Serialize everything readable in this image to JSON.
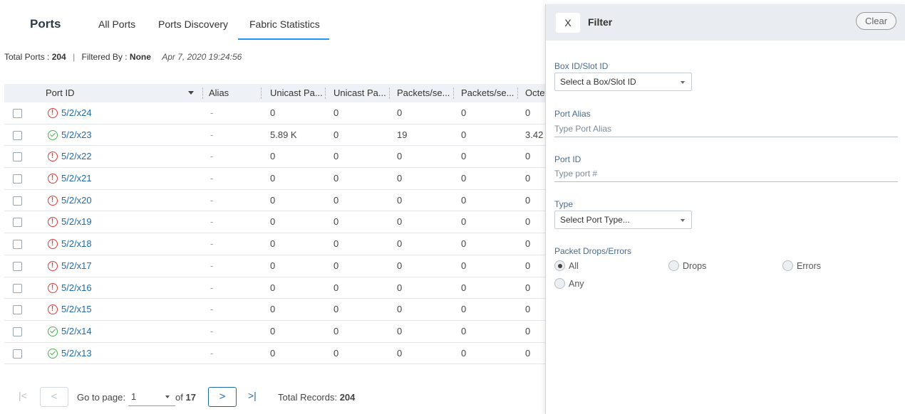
{
  "header": {
    "brand": "Ports",
    "tabs": [
      "All Ports",
      "Ports Discovery",
      "Fabric Statistics"
    ],
    "active_tab": "Fabric Statistics"
  },
  "summary": {
    "total_label": "Total Ports : ",
    "total_value": "204",
    "filtered_label": "Filtered By : ",
    "filtered_value": "None",
    "timestamp": "Apr 7, 2020 19:24:56"
  },
  "table": {
    "columns": [
      "Port ID",
      "Alias",
      "Unicast Pa...",
      "Unicast Pa...",
      "Packets/se...",
      "Packets/se...",
      "Octet"
    ],
    "rows": [
      {
        "port": "5/2/x24",
        "status": "error",
        "alias": "-",
        "c1": "0",
        "c2": "0",
        "c3": "0",
        "c4": "0",
        "c5": "0"
      },
      {
        "port": "5/2/x23",
        "status": "ok",
        "alias": "-",
        "c1": "5.89 K",
        "c2": "0",
        "c3": "19",
        "c4": "0",
        "c5": "3.42"
      },
      {
        "port": "5/2/x22",
        "status": "error",
        "alias": "-",
        "c1": "0",
        "c2": "0",
        "c3": "0",
        "c4": "0",
        "c5": "0"
      },
      {
        "port": "5/2/x21",
        "status": "error",
        "alias": "-",
        "c1": "0",
        "c2": "0",
        "c3": "0",
        "c4": "0",
        "c5": "0"
      },
      {
        "port": "5/2/x20",
        "status": "error",
        "alias": "-",
        "c1": "0",
        "c2": "0",
        "c3": "0",
        "c4": "0",
        "c5": "0"
      },
      {
        "port": "5/2/x19",
        "status": "error",
        "alias": "-",
        "c1": "0",
        "c2": "0",
        "c3": "0",
        "c4": "0",
        "c5": "0"
      },
      {
        "port": "5/2/x18",
        "status": "error",
        "alias": "-",
        "c1": "0",
        "c2": "0",
        "c3": "0",
        "c4": "0",
        "c5": "0"
      },
      {
        "port": "5/2/x17",
        "status": "error",
        "alias": "-",
        "c1": "0",
        "c2": "0",
        "c3": "0",
        "c4": "0",
        "c5": "0"
      },
      {
        "port": "5/2/x16",
        "status": "error",
        "alias": "-",
        "c1": "0",
        "c2": "0",
        "c3": "0",
        "c4": "0",
        "c5": "0"
      },
      {
        "port": "5/2/x15",
        "status": "error",
        "alias": "-",
        "c1": "0",
        "c2": "0",
        "c3": "0",
        "c4": "0",
        "c5": "0"
      },
      {
        "port": "5/2/x14",
        "status": "ok",
        "alias": "-",
        "c1": "0",
        "c2": "0",
        "c3": "0",
        "c4": "0",
        "c5": "0"
      },
      {
        "port": "5/2/x13",
        "status": "ok",
        "alias": "-",
        "c1": "0",
        "c2": "0",
        "c3": "0",
        "c4": "0",
        "c5": "0"
      }
    ]
  },
  "pager": {
    "first_icon": "first-page-icon",
    "prev_icon": "chevron-left-icon",
    "goto_label": "Go to page:",
    "current_page": "1",
    "of_label": "of ",
    "total_pages": "17",
    "next_icon": "chevron-right-icon",
    "last_icon": "last-page-icon",
    "records_label": "Total Records: ",
    "records_value": "204"
  },
  "filter": {
    "close_label": "X",
    "title": "Filter",
    "clear_label": "Clear",
    "box_label": "Box ID/Slot ID",
    "box_placeholder": "Select a Box/Slot ID",
    "alias_label": "Port Alias",
    "alias_placeholder": "Type Port Alias",
    "portid_label": "Port ID",
    "portid_placeholder": "Type port #",
    "type_label": "Type",
    "type_placeholder": "Select Port Type...",
    "drops_label": "Packet Drops/Errors",
    "options": [
      "All",
      "Drops",
      "Errors",
      "Any"
    ],
    "selected_option": "All"
  },
  "colors": {
    "accent": "#2196f3",
    "link": "#1e6aa8",
    "error": "#d93b3b",
    "ok": "#4caf50"
  }
}
